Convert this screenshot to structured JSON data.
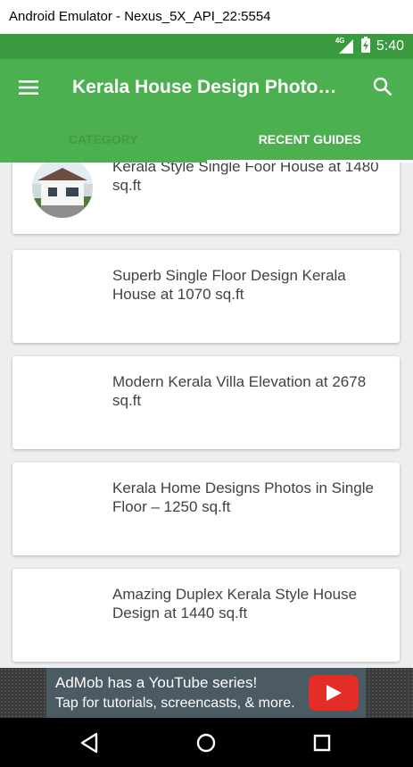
{
  "window": {
    "title": "Android Emulator - Nexus_5X_API_22:5554"
  },
  "status_bar": {
    "network": "4G",
    "time": "5:40"
  },
  "toolbar": {
    "title": "Kerala House Design Photo…",
    "menu_icon": "hamburger-menu-icon",
    "search_icon": "search-icon"
  },
  "tabs": [
    {
      "label": "CATEGORY",
      "active": false
    },
    {
      "label": "RECENT GUIDES",
      "active": true
    }
  ],
  "guides": [
    {
      "title": "Kerala Style Single Foor House at 1480 sq.ft"
    },
    {
      "title": "Superb Single Floor Design Kerala House at 1070 sq.ft"
    },
    {
      "title": "Modern Kerala Villa Elevation at 2678 sq.ft"
    },
    {
      "title": "Kerala Home Designs Photos in Single Floor – 1250 sq.ft"
    },
    {
      "title": "Amazing Duplex Kerala Style House Design at 1440 sq.ft"
    }
  ],
  "ad": {
    "line1": "AdMob has a YouTube series!",
    "line2": "Tap for tutorials, screencasts, & more."
  },
  "colors": {
    "primary": "#4caf50",
    "primary_dark": "#3a9a3f",
    "youtube_red": "#e52d27"
  }
}
